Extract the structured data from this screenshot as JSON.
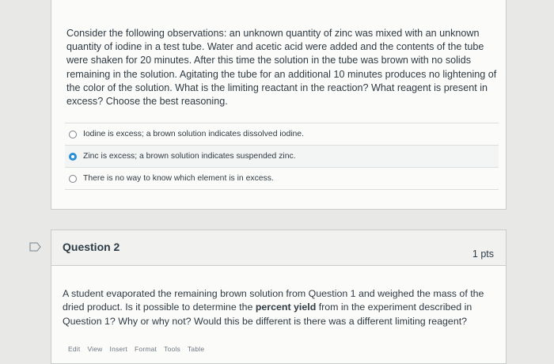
{
  "question1": {
    "prompt": "Consider the following observations: an unknown quantity of zinc was mixed with an unknown quantity of iodine in a test tube. Water and acetic acid were added and the contents of the tube were shaken for 20 minutes. After this time the solution in the tube was brown with no solids remaining in the solution. Agitating the tube for an additional 10 minutes produces no lightening of the color of the solution. What is the limiting reactant in the reaction? What reagent is present in excess? Choose the best reasoning.",
    "answers": [
      {
        "text": "Iodine is excess; a brown solution indicates dissolved iodine.",
        "selected": false
      },
      {
        "text": "Zinc is excess; a brown solution indicates suspended zinc.",
        "selected": true
      },
      {
        "text": "There is no way to know which element is in excess.",
        "selected": false
      }
    ]
  },
  "question2": {
    "title": "Question 2",
    "points": "1 pts",
    "prompt_before": "A student evaporated the remaining brown solution from Question 1 and weighed the mass of the dried product. Is it possible to determine the ",
    "prompt_bold": "percent yield",
    "prompt_after": " from in the experiment described in Question 1? Why or why not? Would this be different is there was a different limiting reagent?",
    "toolbar": [
      "Edit",
      "View",
      "Insert",
      "Format",
      "Tools",
      "Table"
    ]
  },
  "colors": {
    "accent": "#2b8fd6",
    "flag": "#8a96a0"
  },
  "icons": {
    "flag": "flag-icon"
  }
}
